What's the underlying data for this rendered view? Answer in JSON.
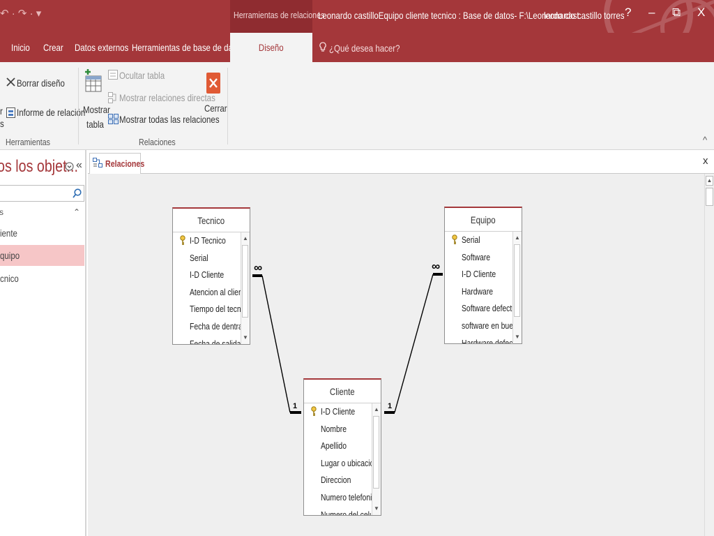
{
  "titlebar": {
    "qat_symbols": "↶ · ↷ · ▾",
    "contextual": "Herramientas de relaciones",
    "document": "Leonardo castilloEquipo cliente tecnico : Base de datos- F:\\Leonardo cast...",
    "user": "leonardo castillo torres",
    "help": "?",
    "minimize": "–",
    "restore": "⧉",
    "close": "X"
  },
  "tabs": {
    "inicio": "Inicio",
    "crear": "Crear",
    "datos_externos": "Datos externos",
    "herramientas_bd": "Herramientas de base de datos",
    "diseno": "Diseño",
    "tell_me": "¿Qué desea hacer?"
  },
  "ribbon": {
    "borrar_diseno": "Borrar diseño",
    "editar_partial_1": "r",
    "editar_partial_2": "s",
    "informe_relacion": "Informe de relación",
    "herramientas_label": "Herramientas",
    "mostrar": "Mostrar",
    "tabla": "tabla",
    "ocultar_tabla": "Ocultar tabla",
    "mostrar_directas": "Mostrar relaciones directas",
    "mostrar_todas": "Mostrar todas las relaciones",
    "relaciones_label": "Relaciones",
    "cerrar": "Cerrar",
    "collapse": "^"
  },
  "nav": {
    "title": "os los objet...",
    "group_mark": "s",
    "items": [
      "iente",
      "quipo",
      "cnico"
    ],
    "selected_index": 1
  },
  "document_tab": {
    "label": "Relaciones",
    "close": "x"
  },
  "tables": {
    "tecnico": {
      "name": "Tecnico",
      "fields": [
        "I-D Tecnico",
        "Serial",
        "I-D Cliente",
        "Atencion al cliente",
        "Tiempo del tecnico",
        "Fecha de dentrada",
        "Fecha de salida de"
      ],
      "primary_key_index": 0
    },
    "equipo": {
      "name": "Equipo",
      "fields": [
        "Serial",
        "Software",
        "I-D Cliente",
        "Hardware",
        "Software defectuoso",
        "software en buen",
        "Hardware defectu"
      ],
      "primary_key_index": 0
    },
    "cliente": {
      "name": "Cliente",
      "fields": [
        "I-D Cliente",
        "Nombre",
        "Apellido",
        "Lugar o ubicacion",
        "Direccion",
        "Numero telefonico",
        "Numero del celular"
      ],
      "primary_key_index": 0
    }
  },
  "relationships": {
    "one_symbol": "1",
    "many_symbol": "∞"
  },
  "colors": {
    "accent": "#a4373a",
    "contextual": "#8f2c30",
    "selected_nav": "#f6c6c7",
    "canvas": "#efefef"
  }
}
